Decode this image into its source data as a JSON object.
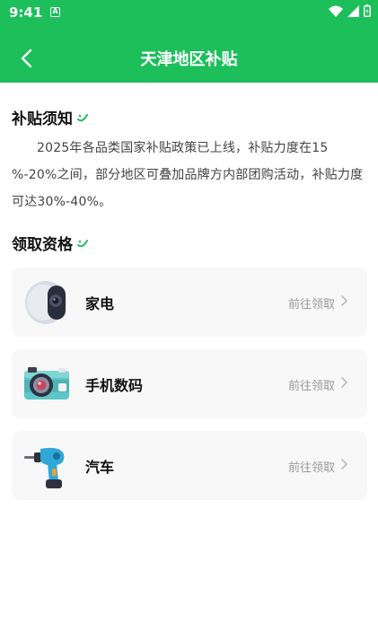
{
  "status_bar": {
    "time": "9:41",
    "a_badge": "A"
  },
  "header": {
    "title": "天津地区补贴",
    "back_icon": "chevron-left-icon",
    "background": "#1cbf5a"
  },
  "notice": {
    "title": "补贴须知",
    "text": "2025年各品类国家补贴政策已上线，补贴力度在15 %-20%之间，部分地区可叠加品牌方内部团购活动，补贴力度可达30%-40%。"
  },
  "qualifications": {
    "title": "领取资格",
    "items": [
      {
        "label": "家电",
        "link": "前往领取",
        "icon": "speaker-icon"
      },
      {
        "label": "手机数码",
        "link": "前往领取",
        "icon": "camera-icon"
      },
      {
        "label": "汽车",
        "link": "前往领取",
        "icon": "drill-icon"
      }
    ]
  },
  "colors": {
    "accent": "#1cbf5a",
    "card_bg": "#f8f8f8",
    "muted": "#999999"
  }
}
